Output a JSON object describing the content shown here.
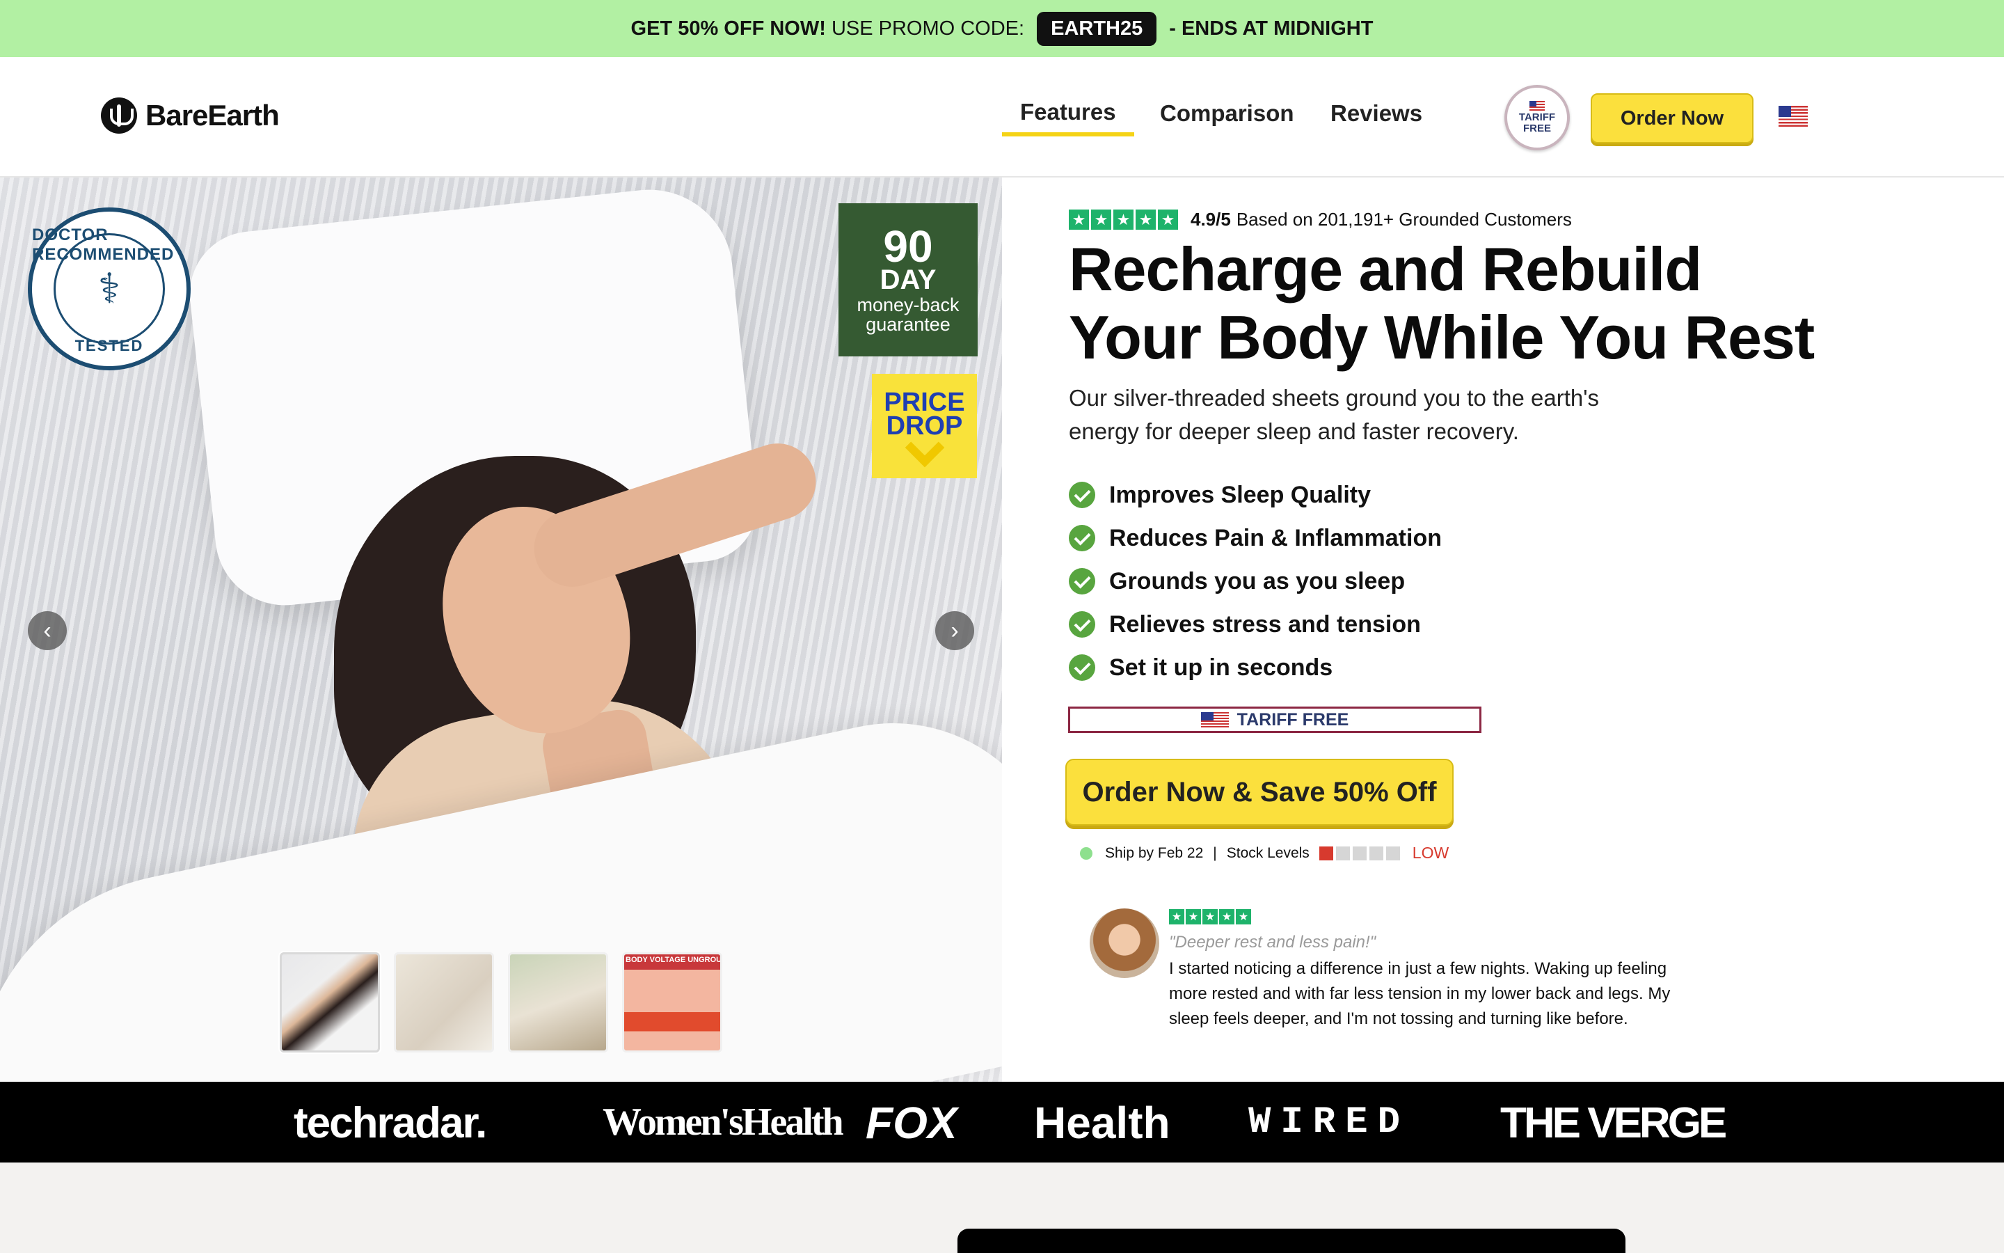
{
  "promo": {
    "lead": "GET 50% OFF NOW!",
    "middle": "USE PROMO CODE:",
    "code": "EARTH25",
    "tail": "- ENDS AT MIDNIGHT"
  },
  "header": {
    "logo_text": "BareEarth",
    "nav": [
      {
        "label": "Features",
        "active": true
      },
      {
        "label": "Comparison",
        "active": false
      },
      {
        "label": "Reviews",
        "active": false
      }
    ],
    "tariff_badge": [
      "TARIFF",
      "FREE"
    ],
    "order_label": "Order Now",
    "flag_icon": "us-flag-icon"
  },
  "gallery": {
    "doctor_badge": {
      "top": "DOCTOR RECOMMENDED",
      "bottom": "TESTED"
    },
    "guarantee": {
      "days": "90",
      "unit": "DAY",
      "line1": "money-back",
      "line2": "guarantee"
    },
    "price_drop": {
      "line1": "PRICE",
      "line2": "DROP"
    },
    "prev_glyph": "‹",
    "next_glyph": "›",
    "thumbnails": 4,
    "active_thumb": 1,
    "thumb4_caption": "BODY VOLTAGE UNGROUNDED"
  },
  "hero": {
    "rating": "4.9/5",
    "rating_text": "Based on 201,191+ Grounded Customers",
    "headline": "Recharge and Rebuild Your Body While You Rest",
    "subtext": "Our silver-threaded sheets ground you to the earth's energy for deeper sleep and faster recovery.",
    "benefits": [
      "Improves Sleep Quality",
      "Reduces Pain & Inflammation",
      "Grounds you as you sleep",
      "Relieves stress and tension",
      "Set it up in seconds"
    ],
    "tariff_bar": "TARIFF FREE",
    "cta_label": "Order Now & Save 50% Off",
    "ship_text": "Ship by Feb 22",
    "separator": "|",
    "stock_label": "Stock Levels",
    "stock_level": 0.2,
    "stock_status": "LOW",
    "stock_color": "#d73a2e"
  },
  "review": {
    "stars": 5,
    "quote": "\"Deeper rest and less pain!\"",
    "body": "I started noticing a difference in just a few nights. Waking up feeling more rested and with far less tension in my lower back and legs. My sleep feels deeper, and I'm not tossing and turning like before."
  },
  "press": [
    "techradar.",
    "Women'sHealth",
    "FOX",
    "Health",
    "WIRED",
    "THE VERGE"
  ],
  "colors": {
    "accent": "#fbe03d",
    "promo_bg": "#b2f0a3",
    "check": "#58a53f",
    "star": "#1eb36b"
  }
}
